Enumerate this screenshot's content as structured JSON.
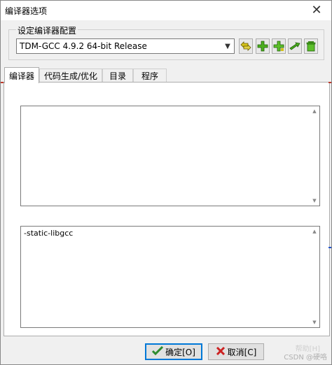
{
  "window": {
    "title": "编译器选项",
    "close_symbol": "✕"
  },
  "compiler_group": {
    "label": "设定编译器配置",
    "selected": "TDM-GCC 4.9.2 64-bit Release"
  },
  "toolbar": {
    "icons": [
      "swap-icon",
      "add-icon",
      "add-copy-icon",
      "rename-icon",
      "delete-icon"
    ]
  },
  "tabs": [
    {
      "label": "编译器",
      "active": true
    },
    {
      "label": "代码生成/优化",
      "active": false
    },
    {
      "label": "目录",
      "active": false
    },
    {
      "label": "程序",
      "active": false
    }
  ],
  "fields": {
    "compile_commands": "",
    "linker_commands": "-static-libgcc"
  },
  "buttons": {
    "ok_label": "确定[O]",
    "cancel_label": "取消[C]"
  },
  "watermark": {
    "faint_text": "帮助[H]",
    "csdn": "CSDN @硬咯"
  },
  "colors": {
    "accent": "#0078d7",
    "ok_check": "#2e8b2e",
    "cancel_x": "#cc2222",
    "tool_green": "#4caf1f"
  }
}
